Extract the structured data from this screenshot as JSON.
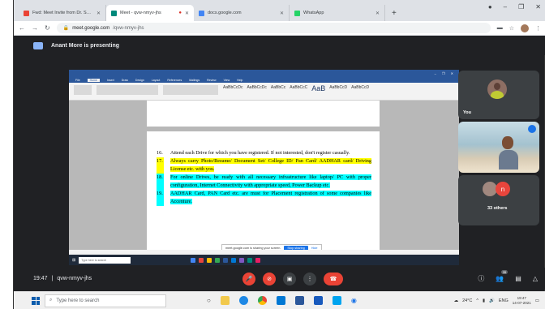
{
  "browser": {
    "tabs": [
      {
        "title": "Fwd: Meet Invite from Dr. Sneha",
        "fav_color": "#ea4335",
        "active": false,
        "recording": false
      },
      {
        "title": "Meet - qvw-nmyv-jhs",
        "fav_color": "#00897b",
        "active": true,
        "recording": true
      },
      {
        "title": "docs.google.com",
        "fav_color": "#4285f4",
        "active": false,
        "recording": false
      },
      {
        "title": "WhatsApp",
        "fav_color": "#25d366",
        "active": false,
        "recording": false
      }
    ],
    "new_tab": "+",
    "url_domain": "meet.google.com",
    "url_path": "/qvw-nmyv-jhs"
  },
  "presenting": {
    "text": "Anant More is presenting"
  },
  "shared_screen": {
    "word_tabs": [
      "File",
      "Home",
      "Insert",
      "Draw",
      "Design",
      "Layout",
      "References",
      "Mailings",
      "Review",
      "View",
      "Help"
    ],
    "active_word_tab": "Home",
    "style_samples": [
      "AaBbCcDc",
      "AaBbCcDc",
      "AaBbCc",
      "AaBbCcC",
      "AaB",
      "AaBbCcD",
      "AaBbCcD"
    ],
    "items": [
      {
        "num": "16.",
        "text": "Attend each Drive for which you have registered. If not interested, don't register casually.",
        "highlight": "none"
      },
      {
        "num": "17.",
        "text": "Always carry Photo/Resume/ Document Set/ College ID/ Pan Card/ AADHAR card/ Driving License etc. with you.",
        "highlight": "yellow"
      },
      {
        "num": "18.",
        "text": "For online Drives, be ready with all necessary infrastructure like laptop/ PC with proper configuration, Internet Connectivity with appropriate speed, Power Backup etc.",
        "highlight": "cyan"
      },
      {
        "num": "19.",
        "text": "AADHAR Card, PAN Card etc. are must for Placement registration of some companies like Accenture.",
        "highlight": "cyan"
      }
    ],
    "share_notice": "meet.google.com is sharing your screen.",
    "stop_label": "Stop sharing",
    "hide_label": "Hide",
    "search_text": "Type here to search"
  },
  "participants": {
    "you_label": "You",
    "others_label": "33 others",
    "initial": "n"
  },
  "meeting": {
    "time": "19:47",
    "code": "qvw-nmyv-jhs",
    "people_count": "35"
  },
  "taskbar": {
    "search_placeholder": "Type here to search",
    "temperature": "24°C",
    "lang": "ENG",
    "time": "19:47",
    "date": "14-07-2021"
  }
}
